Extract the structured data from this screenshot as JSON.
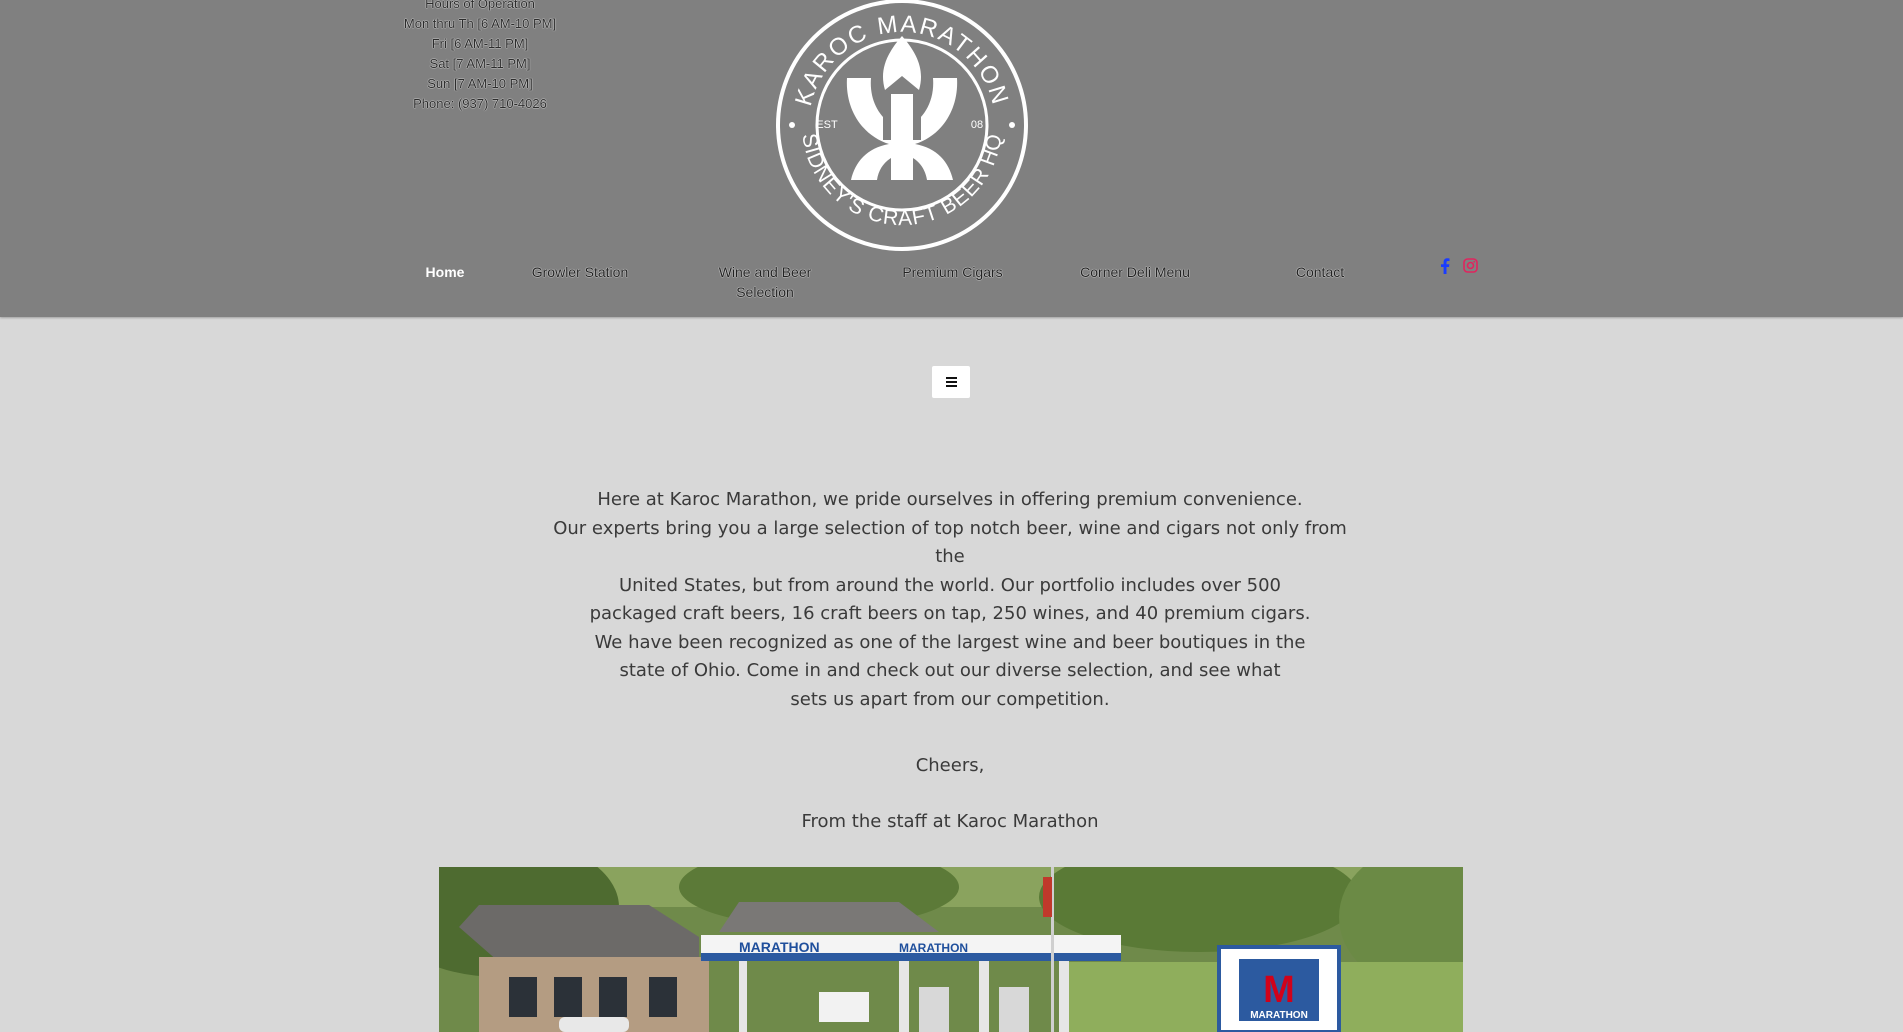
{
  "hours": {
    "title": "Hours of Operation",
    "lines": [
      "Mon thru Th [6 AM-10 PM]",
      "Fri [6 AM-11 PM]",
      "Sat [7 AM-11 PM]",
      "Sun [7 AM-10 PM]",
      "Phone: (937) 710-4026"
    ]
  },
  "logo": {
    "top_text": "KAROC MARATHON",
    "bottom_text": "SIDNEY'S CRAFT BEER HQ",
    "est_left": "EST",
    "est_right": "08"
  },
  "nav": {
    "items": [
      "Home",
      "Growler Station",
      "Wine and Beer Selection",
      "Premium Cigars",
      "Corner Deli Menu",
      "Contact"
    ],
    "active_index": 0
  },
  "social": {
    "icons": [
      "facebook-icon",
      "instagram-icon"
    ],
    "colors": {
      "facebook": "#1a3cff",
      "instagram": "#e0245e"
    }
  },
  "menu_toggle": {
    "icon": "hamburger-icon"
  },
  "content": {
    "intro_lines": [
      "Here at Karoc Marathon, we pride ourselves in offering premium convenience.",
      "Our experts bring you a large selection of top notch beer, wine and cigars not only from the",
      "United States, but from around the world. Our portfolio includes over 500",
      "packaged craft beers, 16 craft beers on tap, 250 wines, and 40 premium cigars.",
      "We have been recognized as one of the largest wine and beer boutiques in the",
      "state of Ohio. Come in and check out our diverse selection, and see what",
      "sets us apart from our competition."
    ],
    "cheers": "Cheers,",
    "signoff": "From the staff at Karoc Marathon"
  },
  "photo": {
    "signs": [
      "MARATHON",
      "MARATHON",
      "M",
      "MARATHON"
    ]
  },
  "colors": {
    "header_bg": "#808080",
    "page_bg": "#d8d8d8",
    "text": "#3a3a3a"
  }
}
